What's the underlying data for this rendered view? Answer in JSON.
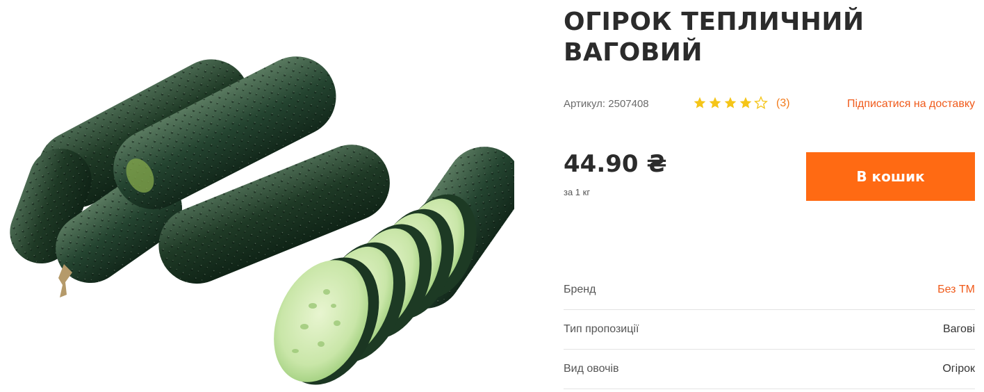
{
  "product": {
    "title": "ОГІРОК ТЕПЛИЧНИЙ ВАГОВИЙ",
    "image_alt": "cucumbers-image",
    "sku_text": "Артикул: 2507408",
    "rating": {
      "value": 4,
      "max": 5,
      "review_count": "(3)"
    },
    "subscribe_label": "Підписатися на доставку",
    "price": "44.90 ₴",
    "per_unit": "за 1 кг",
    "cart_button_label": "В кошик"
  },
  "attributes": [
    {
      "label": "Бренд",
      "value": "Без ТМ",
      "is_link": true
    },
    {
      "label": "Тип пропозиції",
      "value": "Вагові",
      "is_link": false
    },
    {
      "label": "Вид овочів",
      "value": "Огірок",
      "is_link": false
    }
  ],
  "colors": {
    "accent": "#ff6a13",
    "link": "#f05a1a",
    "star_filled": "#f5c518",
    "star_empty": "#f5c518"
  }
}
